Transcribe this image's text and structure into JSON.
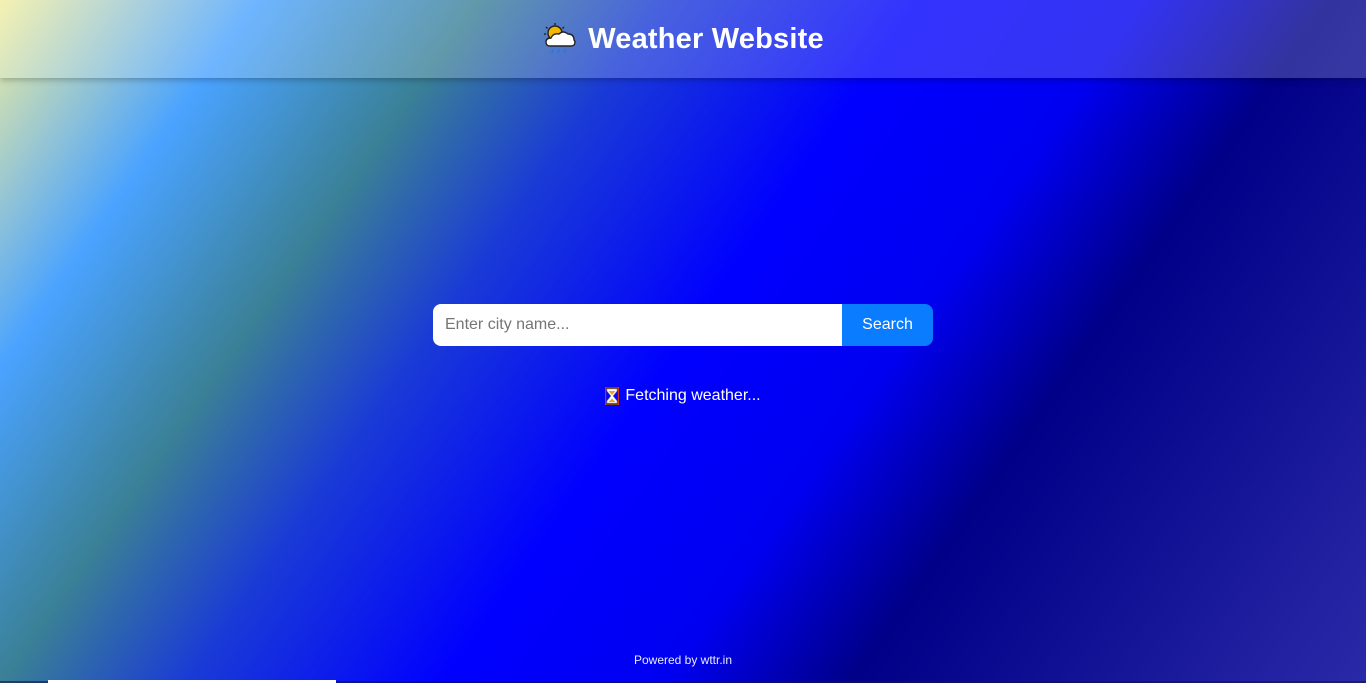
{
  "header": {
    "title": "Weather Website",
    "logo_icon": "sun-behind-rain-cloud-icon"
  },
  "search": {
    "placeholder": "Enter city name...",
    "value": "",
    "button_label": "Search"
  },
  "status": {
    "icon": "hourglass-icon",
    "text": "Fetching weather..."
  },
  "footer": {
    "text": "Powered by wttr.in"
  },
  "colors": {
    "search_button": "#0a7cff",
    "text": "#ffffff"
  }
}
